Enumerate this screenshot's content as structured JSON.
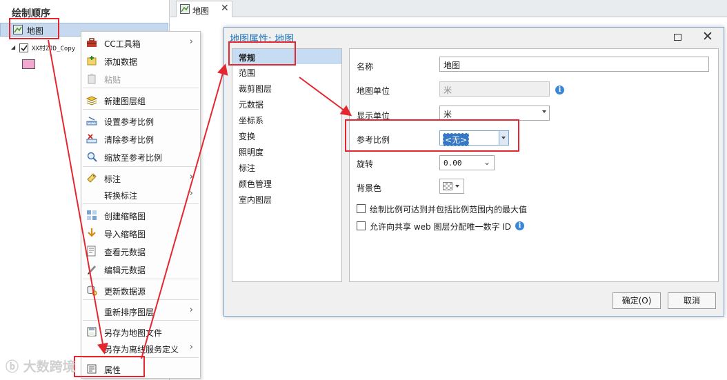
{
  "contents_pane": {
    "title": "绘制顺序",
    "map_item": "地图",
    "layer_name": "XX村ZJD_Copy",
    "swatch_color": "#f4a7d0"
  },
  "tab": {
    "label": "地图",
    "close": "✕"
  },
  "context_menu": {
    "items": [
      {
        "label": "CC工具箱",
        "icon": "toolbox-icon",
        "submenu": true
      },
      {
        "label": "添加数据",
        "icon": "add-data-icon"
      },
      {
        "label": "粘贴",
        "icon": "paste-icon",
        "disabled": true
      },
      {
        "label": "新建图层组",
        "icon": "layer-group-icon"
      },
      {
        "label": "设置参考比例",
        "icon": "set-scale-icon"
      },
      {
        "label": "清除参考比例",
        "icon": "clear-scale-icon"
      },
      {
        "label": "缩放至参考比例",
        "icon": "zoom-scale-icon"
      },
      {
        "label": "标注",
        "icon": "label-icon",
        "submenu": true
      },
      {
        "label": "转换标注",
        "submenu": true
      },
      {
        "label": "创建缩略图",
        "icon": "thumbnail-icon"
      },
      {
        "label": "导入缩略图",
        "icon": "import-icon"
      },
      {
        "label": "查看元数据",
        "icon": "metadata-view-icon"
      },
      {
        "label": "编辑元数据",
        "icon": "metadata-edit-icon"
      },
      {
        "label": "更新数据源",
        "icon": "datasource-icon"
      },
      {
        "label": "重新排序图层",
        "submenu": true
      },
      {
        "label": "另存为地图文件",
        "icon": "save-map-icon"
      },
      {
        "label": "另存为离线服务定义",
        "submenu": true
      },
      {
        "label": "属性",
        "icon": "properties-icon"
      }
    ]
  },
  "dialog": {
    "title": "地图属性: 地图",
    "nav": [
      "常规",
      "范围",
      "裁剪图层",
      "元数据",
      "坐标系",
      "变换",
      "照明度",
      "标注",
      "颜色管理",
      "室内图层"
    ],
    "active_nav": "常规",
    "fields": {
      "name_label": "名称",
      "name_value": "地图",
      "map_units_label": "地图单位",
      "map_units_value": "米",
      "display_units_label": "显示单位",
      "display_units_value": "米",
      "ref_scale_label": "参考比例",
      "ref_scale_value": "<无>",
      "rotation_label": "旋转",
      "rotation_value": "0.00",
      "bg_color_label": "背景色"
    },
    "checkboxes": [
      {
        "label": "绘制比例可达到并包括比例范围内的最大值",
        "checked": false
      },
      {
        "label": "允许向共享 web 图层分配唯一数字 ID",
        "checked": false
      }
    ],
    "ok_label": "确定(O)",
    "cancel_label": "取消"
  },
  "annotation_color": "#e3262f",
  "watermark": "大数跨境"
}
